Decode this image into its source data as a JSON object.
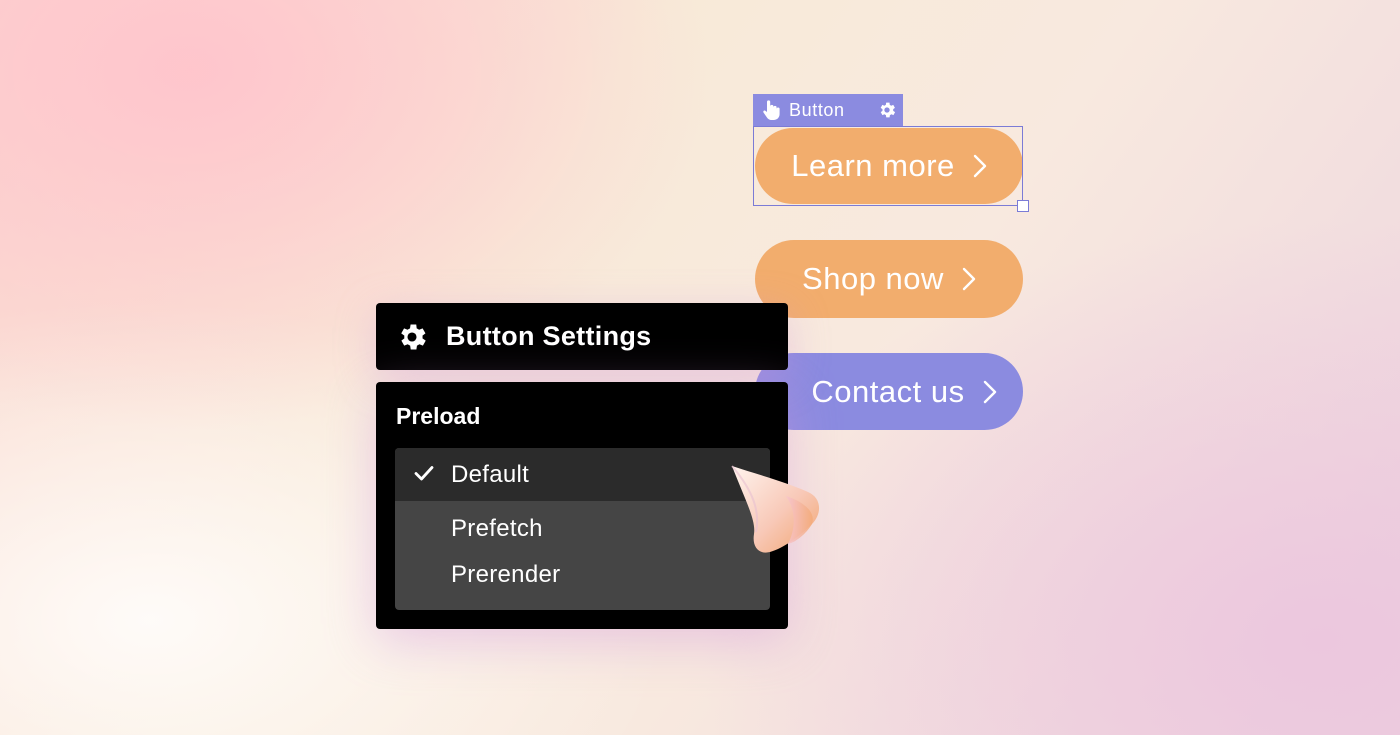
{
  "canvas": {
    "selection_tag": {
      "label": "Button",
      "hand_icon": "hand-pointer-icon",
      "gear_icon": "gear-icon"
    },
    "buttons": [
      {
        "label": "Learn more",
        "color": "#f2ad6d"
      },
      {
        "label": "Shop now",
        "color": "#f2ad6d"
      },
      {
        "label": "Contact us",
        "color": "#8b8be0"
      }
    ]
  },
  "settings_panel": {
    "title": "Button Settings",
    "icon": "gear-icon",
    "section_label": "Preload",
    "options": [
      {
        "label": "Default",
        "selected": true
      },
      {
        "label": "Prefetch",
        "selected": false
      },
      {
        "label": "Prerender",
        "selected": false
      }
    ]
  },
  "colors": {
    "accent_purple": "#8b8be0",
    "accent_orange": "#f2ad6d",
    "panel_bg": "#000000",
    "dropdown_bg": "#454545"
  }
}
